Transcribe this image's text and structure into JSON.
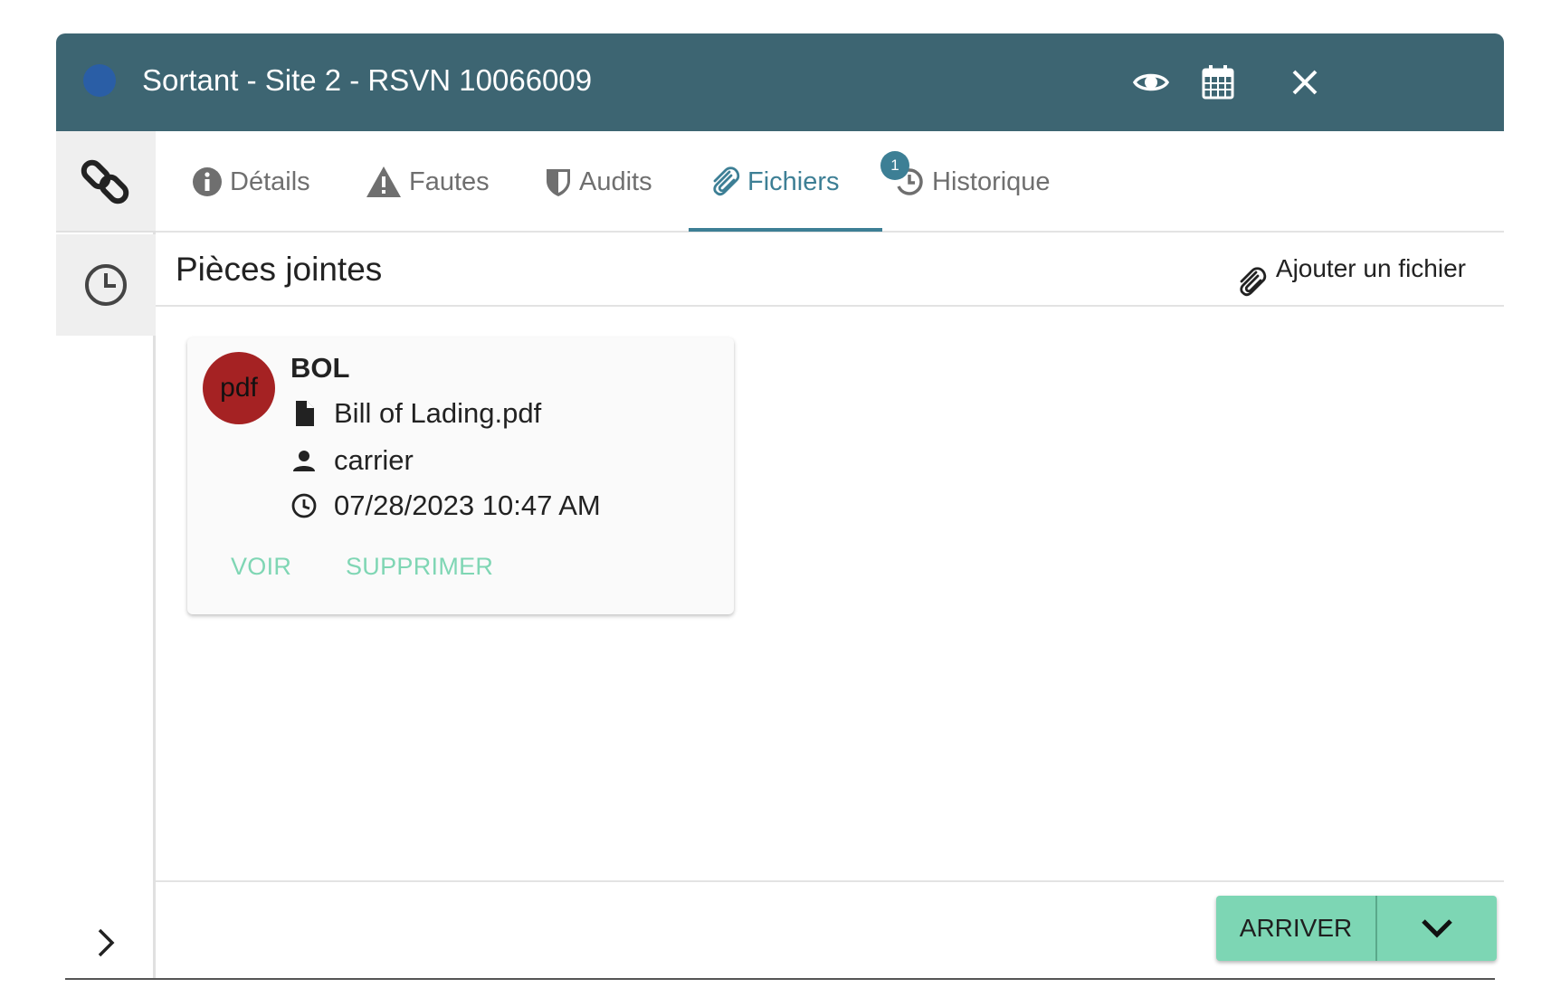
{
  "header": {
    "title": "Sortant - Site 2 - RSVN 10066009",
    "status_color": "#2a5ea6",
    "background": "#3d6572",
    "icons": [
      "eye-icon",
      "calendar-icon",
      "close-icon"
    ]
  },
  "sidebar": {
    "items": [
      {
        "icon": "link-icon"
      },
      {
        "icon": "clock-icon"
      }
    ],
    "expand_icon": "chevron-right-icon"
  },
  "tabs": [
    {
      "label": "Détails",
      "icon": "info-icon",
      "active": false
    },
    {
      "label": "Fautes",
      "icon": "warning-icon",
      "active": false
    },
    {
      "label": "Audits",
      "icon": "shield-icon",
      "active": false
    },
    {
      "label": "Fichiers",
      "icon": "paperclip-icon",
      "active": true,
      "badge": "1"
    },
    {
      "label": "Historique",
      "icon": "history-icon",
      "active": false
    }
  ],
  "section": {
    "title": "Pièces jointes",
    "add_file_label": "Ajouter un fichier"
  },
  "files": [
    {
      "type_label": "pdf",
      "type_color": "#a52223",
      "name": "BOL",
      "filename": "Bill of Lading.pdf",
      "uploaded_by": "carrier",
      "uploaded_at": "07/28/2023 10:47 AM",
      "actions": {
        "view": "VOIR",
        "delete": "SUPPRIMER"
      }
    }
  ],
  "footer": {
    "primary_action": "ARRIVER",
    "accent": "#7dd6b4"
  }
}
